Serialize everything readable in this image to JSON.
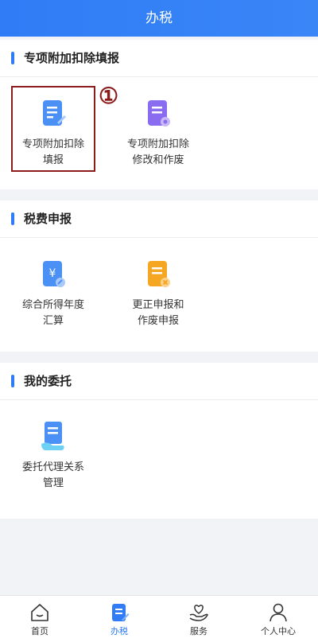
{
  "header": {
    "title": "办税"
  },
  "sections": [
    {
      "title": "专项附加扣除填报",
      "items": [
        {
          "label_line1": "专项附加扣除",
          "label_line2": "填报",
          "icon": "document-edit-icon"
        },
        {
          "label_line1": "专项附加扣除",
          "label_line2": "修改和作废",
          "icon": "document-settings-icon"
        }
      ]
    },
    {
      "title": "税费申报",
      "items": [
        {
          "label_line1": "综合所得年度",
          "label_line2": "汇算",
          "icon": "yuan-document-icon"
        },
        {
          "label_line1": "更正申报和",
          "label_line2": "作废申报",
          "icon": "document-cancel-icon"
        }
      ]
    },
    {
      "title": "我的委托",
      "items": [
        {
          "label_line1": "委托代理关系",
          "label_line2": "管理",
          "icon": "entrust-document-icon"
        }
      ]
    }
  ],
  "annotation": {
    "marker": "①"
  },
  "tabbar": {
    "tabs": [
      {
        "label": "首页",
        "icon": "home-icon"
      },
      {
        "label": "办税",
        "icon": "tax-doc-icon",
        "active": true
      },
      {
        "label": "服务",
        "icon": "heart-hand-icon"
      },
      {
        "label": "个人中心",
        "icon": "user-icon"
      }
    ]
  },
  "colors": {
    "primary": "#2f7cf6",
    "highlight": "#8c1c1c",
    "orange": "#f5a623",
    "purple": "#8a6cf0"
  }
}
